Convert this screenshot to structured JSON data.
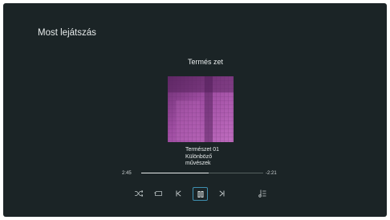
{
  "header": {
    "title": "Most lejátszás"
  },
  "album": {
    "title": "Termés zet"
  },
  "track": {
    "title": "Természet 01",
    "artist": "Különböző művészek"
  },
  "progress": {
    "elapsed": "2:45",
    "remaining": "-2:21",
    "fraction": 0.55
  },
  "controls": [
    {
      "name": "shuffle-icon"
    },
    {
      "name": "repeat-icon"
    },
    {
      "name": "previous-icon"
    },
    {
      "name": "pause-icon"
    },
    {
      "name": "next-icon"
    },
    {
      "name": "playlist-icon"
    }
  ],
  "colors": {
    "background": "#1b2426",
    "accent": "#3f8fb0",
    "art_base": "#9b4a9e"
  }
}
